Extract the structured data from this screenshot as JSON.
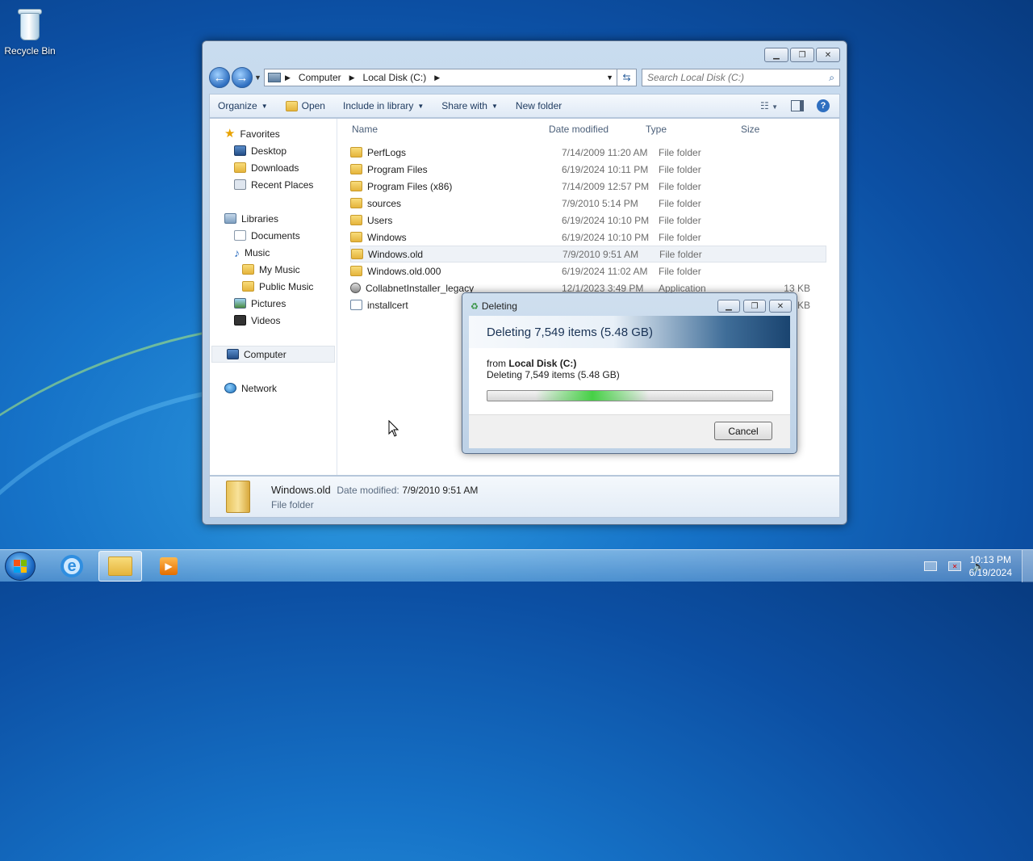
{
  "desktop": {
    "recycle_bin_label": "Recycle Bin"
  },
  "explorer": {
    "address": {
      "crumbs": [
        "Computer",
        "Local Disk (C:)"
      ]
    },
    "search_placeholder": "Search Local Disk (C:)",
    "toolbar": {
      "organize": "Organize",
      "open": "Open",
      "include_in_library": "Include in library",
      "share_with": "Share with",
      "new_folder": "New folder"
    },
    "nav": {
      "favorites": "Favorites",
      "desktop": "Desktop",
      "downloads": "Downloads",
      "recent_places": "Recent Places",
      "libraries": "Libraries",
      "documents": "Documents",
      "music": "Music",
      "my_music": "My Music",
      "public_music": "Public Music",
      "pictures": "Pictures",
      "videos": "Videos",
      "computer": "Computer",
      "network": "Network"
    },
    "columns": {
      "name": "Name",
      "date": "Date modified",
      "type": "Type",
      "size": "Size"
    },
    "files": [
      {
        "name": "PerfLogs",
        "date": "7/14/2009 11:20 AM",
        "type": "File folder",
        "size": ""
      },
      {
        "name": "Program Files",
        "date": "6/19/2024 10:11 PM",
        "type": "File folder",
        "size": ""
      },
      {
        "name": "Program Files (x86)",
        "date": "7/14/2009 12:57 PM",
        "type": "File folder",
        "size": ""
      },
      {
        "name": "sources",
        "date": "7/9/2010 5:14 PM",
        "type": "File folder",
        "size": ""
      },
      {
        "name": "Users",
        "date": "6/19/2024 10:10 PM",
        "type": "File folder",
        "size": ""
      },
      {
        "name": "Windows",
        "date": "6/19/2024 10:10 PM",
        "type": "File folder",
        "size": ""
      },
      {
        "name": "Windows.old",
        "date": "7/9/2010 9:51 AM",
        "type": "File folder",
        "size": ""
      },
      {
        "name": "Windows.old.000",
        "date": "6/19/2024 11:02 AM",
        "type": "File folder",
        "size": ""
      },
      {
        "name": "CollabnetInstaller_legacy",
        "date": "12/1/2023 3:49 PM",
        "type": "Application",
        "size": "13 KB"
      },
      {
        "name": "installcert",
        "date": "",
        "type": "",
        "size": "KB"
      }
    ],
    "details": {
      "name": "Windows.old",
      "date_label": "Date modified:",
      "date_value": "7/9/2010 9:51 AM",
      "type": "File folder"
    }
  },
  "dialog": {
    "title": "Deleting",
    "banner": "Deleting 7,549 items (5.48 GB)",
    "from_label": "from",
    "from_value": "Local Disk (C:)",
    "status": "Deleting 7,549 items (5.48 GB)",
    "cancel": "Cancel"
  },
  "taskbar": {
    "time": "10:13 PM",
    "date": "6/19/2024"
  }
}
